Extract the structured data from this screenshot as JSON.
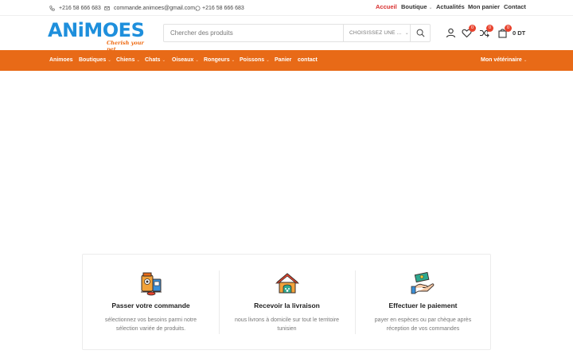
{
  "topbar": {
    "phone1": "+216 58 666 683",
    "email": "commande.animoes@gmail.com",
    "whatsapp": "+216 58 666 683",
    "nav": [
      {
        "label": "Accueil",
        "active": true,
        "dropdown": false
      },
      {
        "label": "Boutique",
        "active": false,
        "dropdown": true
      },
      {
        "label": "Actualités",
        "active": false,
        "dropdown": false
      },
      {
        "label": "Mon panier",
        "active": false,
        "dropdown": false
      },
      {
        "label": "Contact",
        "active": false,
        "dropdown": false
      }
    ]
  },
  "logo": {
    "word": "ANiMOES",
    "tagline": "Cherish your pet"
  },
  "search": {
    "placeholder": "Chercher des produits",
    "category": "CHOISISSEZ UNE ..."
  },
  "header_icons": {
    "account": "user-icon",
    "wishlist_count": "0",
    "compare_count": "0",
    "cart_count": "0",
    "cart_total": "0 DT"
  },
  "mainnav": {
    "items": [
      {
        "label": "Animoes",
        "dropdown": false
      },
      {
        "label": "Boutiques",
        "dropdown": true
      },
      {
        "label": "Chiens",
        "dropdown": true
      },
      {
        "label": "Chats",
        "dropdown": true
      },
      {
        "label": "Oiseaux",
        "dropdown": true
      },
      {
        "label": "Rongeurs",
        "dropdown": true
      },
      {
        "label": "Poissons",
        "dropdown": true
      },
      {
        "label": "Panier",
        "dropdown": false
      },
      {
        "label": "contact",
        "dropdown": false
      }
    ],
    "right": {
      "label": "Mon vétérinaire",
      "dropdown": true
    }
  },
  "features": [
    {
      "icon": "pet-food-icon",
      "title": "Passer votre commande",
      "desc": "sélectionnez vos besoins parmi notre sélection variée de produits."
    },
    {
      "icon": "pet-house-icon",
      "title": "Recevoir la livraison",
      "desc": "nous livrons à domicile sur tout le territoire tunisien"
    },
    {
      "icon": "payment-hand-icon",
      "title": "Effectuer le paiement",
      "desc": "payer en espèces ou par chèque après réception de vos commandes"
    }
  ],
  "colors": {
    "accent": "#e86a17",
    "logo_blue": "#1e8fdc",
    "badge": "#e8432e",
    "active_link": "#d82e2e"
  }
}
